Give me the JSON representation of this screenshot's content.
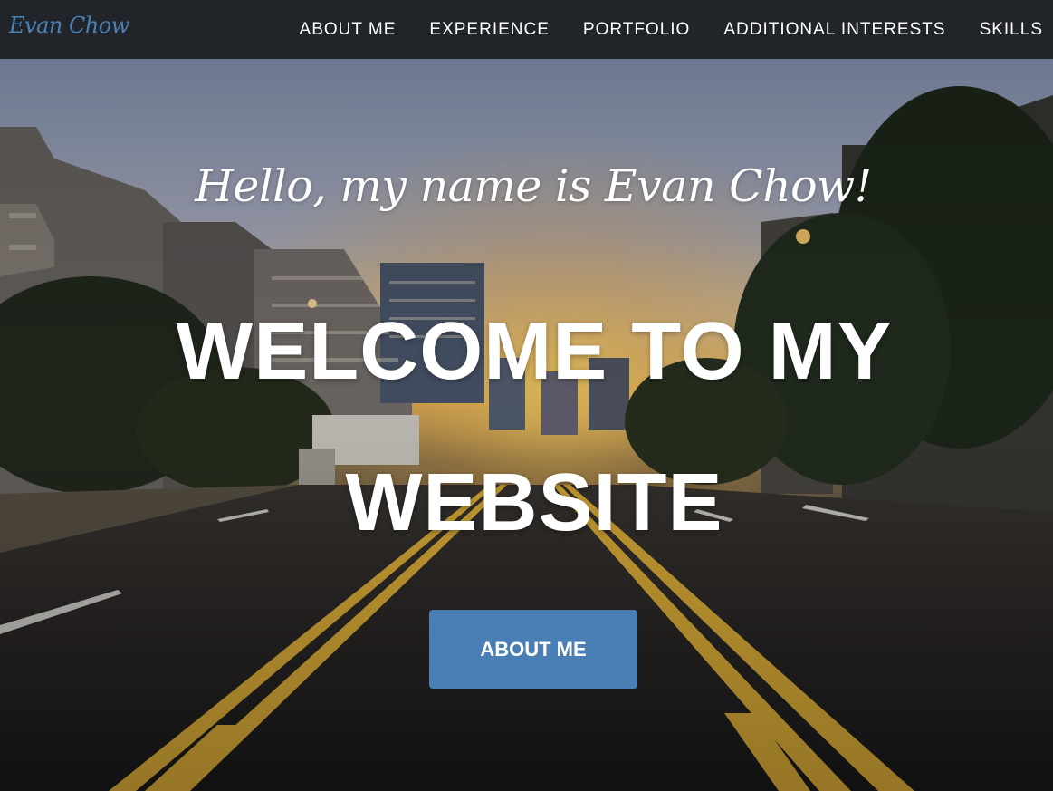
{
  "navbar": {
    "brand": "Evan Chow",
    "links": [
      {
        "label": "ABOUT ME"
      },
      {
        "label": "EXPERIENCE"
      },
      {
        "label": "PORTFOLIO"
      },
      {
        "label": "ADDITIONAL INTERESTS"
      },
      {
        "label": "SKILLS"
      }
    ]
  },
  "hero": {
    "lead_in": "Hello, my name is Evan Chow!",
    "heading": "WELCOME TO MY WEBSITE",
    "button_label": "ABOUT ME",
    "background_description_icon": "city-street-sunset-photo"
  },
  "colors": {
    "navbar_bg": "#212529",
    "brand": "#4a82b8",
    "button": "#4a7fb5",
    "text": "#ffffff"
  }
}
